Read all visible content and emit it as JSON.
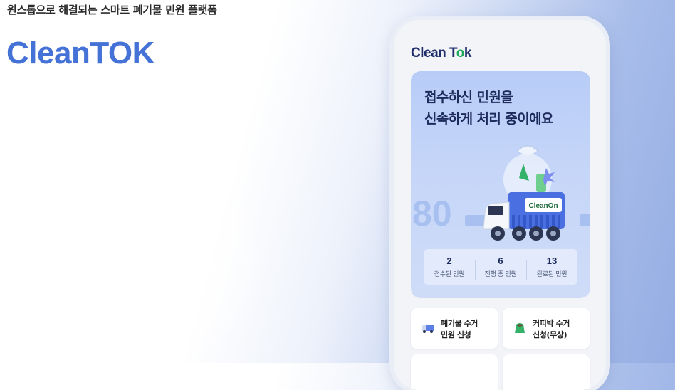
{
  "tagline": "원스톱으로 해결되는 스마트 폐기물 민원 플랫폼",
  "brand": "CleanTOK",
  "phone": {
    "logo": {
      "prefix": "Clean T",
      "o": "o",
      "suffix": "k"
    },
    "hero": {
      "title_line1": "접수하신 민원을",
      "title_line2": "신속하게 처리 중이에요",
      "truck_logo": "CleanOn",
      "background_number": "80"
    },
    "stats": [
      {
        "value": "2",
        "label": "접수된 민원"
      },
      {
        "value": "6",
        "label": "진행 중 민원"
      },
      {
        "value": "13",
        "label": "완료된 민원"
      }
    ],
    "menu": [
      {
        "line1": "폐기물 수거",
        "line2": "민원 신청",
        "icon": "truck-icon"
      },
      {
        "line1": "커피박 수거",
        "line2": "신청(무상)",
        "icon": "coffee-bag-icon"
      }
    ]
  },
  "colors": {
    "brand": "#4472d6",
    "hero_bg": "#c6d6f8",
    "truck_blue": "#4a6fe0",
    "leaf_green": "#34b26a"
  }
}
